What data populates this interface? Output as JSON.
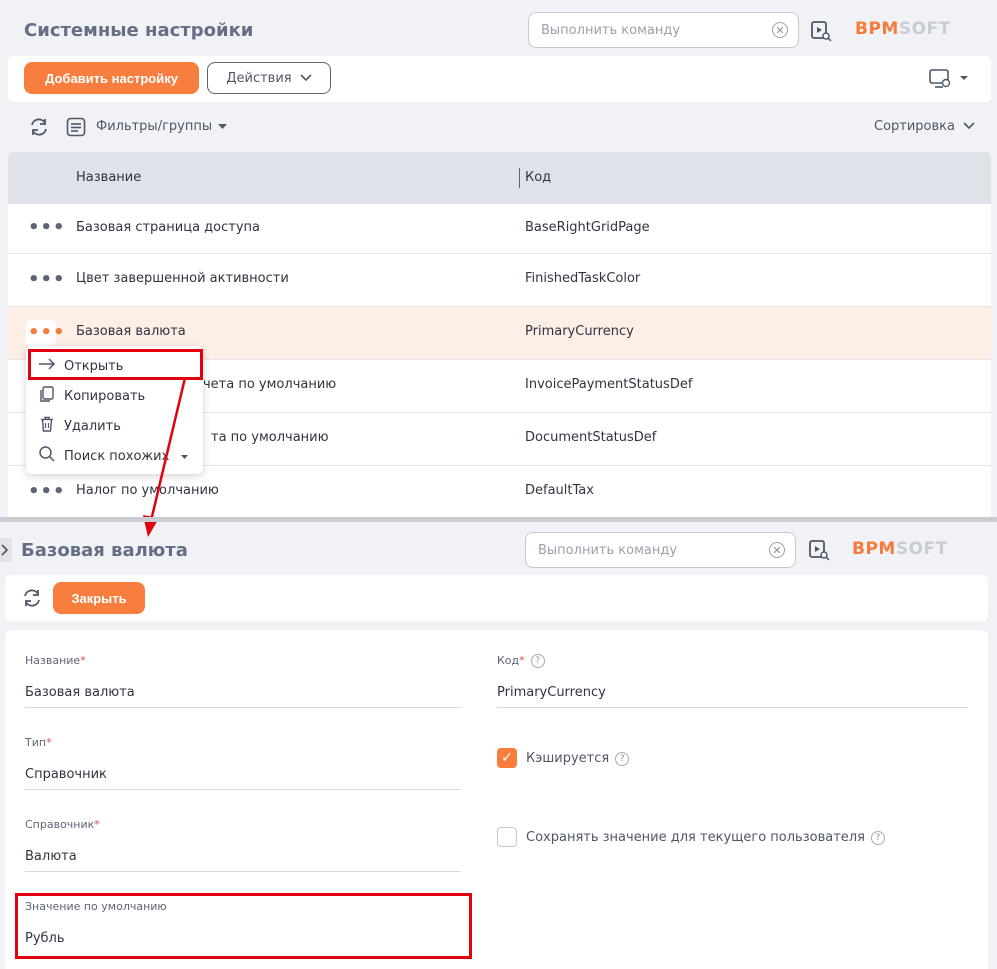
{
  "top": {
    "title": "Системные настройки",
    "command_placeholder": "Выполнить команду",
    "logo_part1": "BPM",
    "logo_part2": "SOFT",
    "add_button": "Добавить настройку",
    "actions_button": "Действия",
    "filters_label": "Фильтры/группы",
    "sort_label": "Сортировка"
  },
  "grid": {
    "columns": [
      "Название",
      "Код"
    ],
    "rows": [
      {
        "name": "Базовая страница доступа",
        "code": "BaseRightGridPage"
      },
      {
        "name": "Цвет завершенной активности",
        "code": "FinishedTaskColor"
      },
      {
        "name": "Базовая валюта",
        "code": "PrimaryCurrency"
      },
      {
        "name": "Статус оплаты счета по умолчанию",
        "code": "InvoicePaymentStatusDef"
      },
      {
        "name": "Статус документа по умолчанию",
        "code": "DocumentStatusDef"
      },
      {
        "name": "Налог по умолчанию",
        "code": "DefaultTax"
      }
    ],
    "row3_visible_name": "чета по умолчанию",
    "row4_visible_name": "та по умолчанию",
    "row5_visible_name": "Налог по умолчанию"
  },
  "context_menu": {
    "items": [
      "Открыть",
      "Копировать",
      "Удалить",
      "Поиск похожих"
    ]
  },
  "card": {
    "title": "Базовая валюта",
    "command_placeholder": "Выполнить команду",
    "logo_part1": "BPM",
    "logo_part2": "SOFT",
    "close_button": "Закрыть",
    "name_label": "Название",
    "name_value": "Базовая валюта",
    "code_label": "Код",
    "code_value": "PrimaryCurrency",
    "type_label": "Тип",
    "type_value": "Справочник",
    "lookup_label": "Справочник",
    "lookup_value": "Валюта",
    "default_label": "Значение по умолчанию",
    "default_value": "Рубль",
    "cached_label": "Кэшируется",
    "cached_checked": true,
    "save_user_label": "Сохранять значение для текущего пользователя",
    "save_user_checked": false,
    "required_mark": "*",
    "help_mark": "?"
  },
  "colors": {
    "accent": "#f77e3f",
    "highlight": "#e3000f",
    "selected_row": "#fdeee6"
  }
}
